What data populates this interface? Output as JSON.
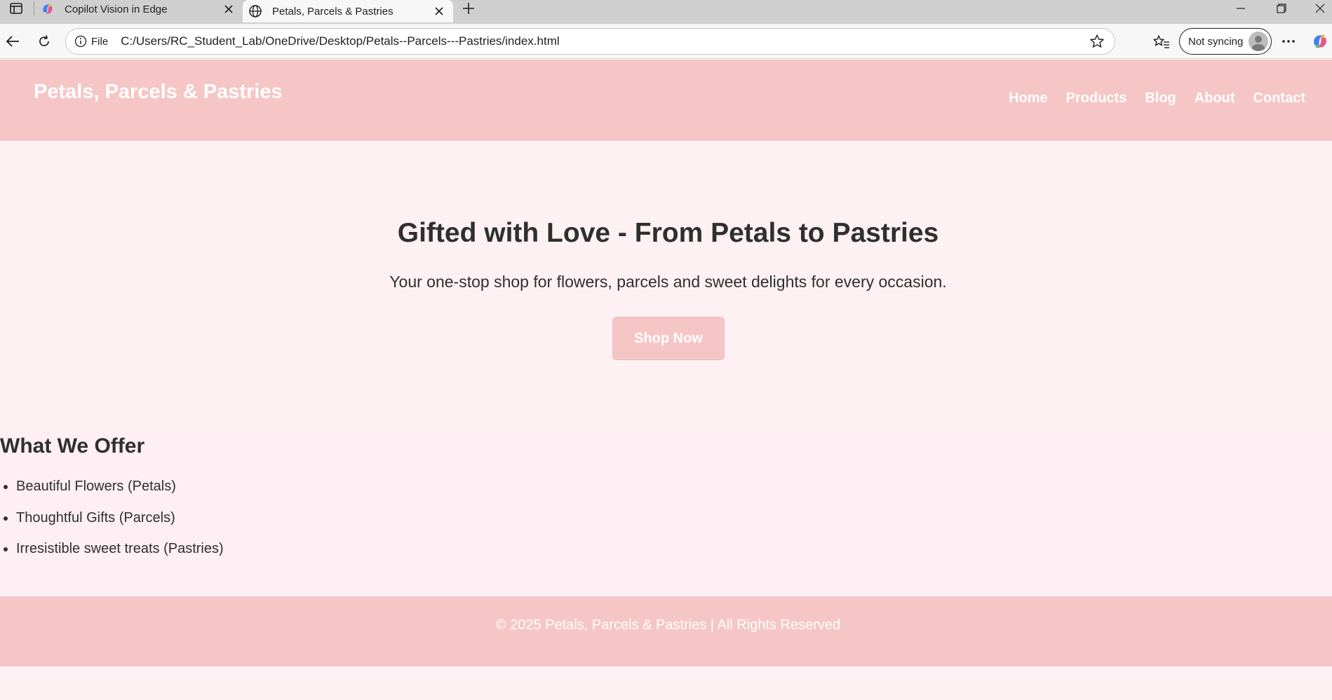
{
  "browser": {
    "tabs": [
      {
        "title": "Copilot Vision in Edge",
        "icon": "copilot-icon",
        "active": false
      },
      {
        "title": "Petals, Parcels & Pastries",
        "icon": "globe-icon",
        "active": true
      }
    ],
    "address": {
      "scheme_label": "File",
      "url": "C:/Users/RC_Student_Lab/OneDrive/Desktop/Petals--Parcels---Pastries/index.html"
    },
    "profile": {
      "label": "Not syncing"
    }
  },
  "site": {
    "logo": "Petals, Parcels & Pastries",
    "nav": [
      "Home",
      "Products",
      "Blog",
      "About",
      "Contact"
    ],
    "hero": {
      "title": "Gifted with Love - From Petals to Pastries",
      "subtitle": "Your one-stop shop for flowers, parcels and sweet delights for every occasion.",
      "cta": "Shop Now"
    },
    "offer": {
      "title": "What We Offer",
      "items": [
        "Beautiful Flowers (Petals)",
        "Thoughtful Gifts (Parcels)",
        "Irresistible sweet treats (Pastries)"
      ]
    },
    "footer": "© 2025 Petals, Parcels & Pastries | All Rights Reserved"
  },
  "colors": {
    "header_bg": "#f6c6c6",
    "page_bg": "#fef1f4",
    "text_dark": "#2f2f2f",
    "text_light": "#ffffff"
  }
}
